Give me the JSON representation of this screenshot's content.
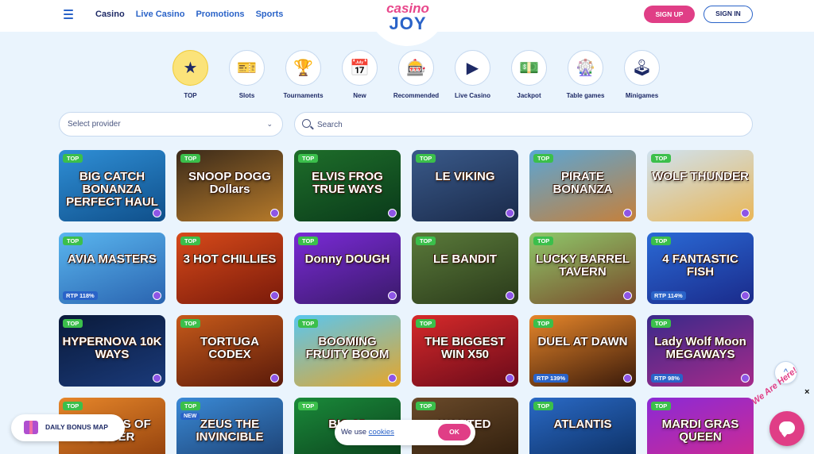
{
  "header": {
    "nav": [
      {
        "label": "Casino",
        "active": true
      },
      {
        "label": "Live Casino",
        "active": false
      },
      {
        "label": "Promotions",
        "active": false
      },
      {
        "label": "Sports",
        "active": false
      }
    ],
    "logo_top": "casino",
    "logo_bottom": "JOY",
    "signup_label": "SIGN UP",
    "signin_label": "SIGN IN"
  },
  "categories": [
    {
      "label": "TOP",
      "icon": "star-icon",
      "glyph": "★",
      "active": true
    },
    {
      "label": "Slots",
      "icon": "slot-ticket-icon",
      "glyph": "🎫",
      "active": false
    },
    {
      "label": "Tournaments",
      "icon": "trophy-icon",
      "glyph": "🏆",
      "active": false
    },
    {
      "label": "New",
      "icon": "new-calendar-icon",
      "glyph": "📅",
      "active": false
    },
    {
      "label": "Recommended",
      "icon": "win-badge-icon",
      "glyph": "🎰",
      "active": false
    },
    {
      "label": "Live Casino",
      "icon": "play-icon",
      "glyph": "▶",
      "active": false
    },
    {
      "label": "Jackpot",
      "icon": "money-icon",
      "glyph": "💵",
      "active": false
    },
    {
      "label": "Table games",
      "icon": "roulette-icon",
      "glyph": "🎡",
      "active": false
    },
    {
      "label": "Minigames",
      "icon": "joystick-icon",
      "glyph": "🕹",
      "active": false
    }
  ],
  "filters": {
    "provider_placeholder": "Select provider",
    "search_placeholder": "Search"
  },
  "games": [
    {
      "title": "BIG CATCH BONANZA PERFECT HAUL",
      "top": "TOP",
      "bg": "linear-gradient(160deg,#2f8fd6,#0f4f8a)"
    },
    {
      "title": "SNOOP DOGG Dollars",
      "top": "TOP",
      "bg": "linear-gradient(160deg,#3a2a1a,#b67a2a)"
    },
    {
      "title": "ELVIS FROG TRUE WAYS",
      "top": "TOP",
      "bg": "linear-gradient(160deg,#1e6e2a,#0a3a1a)"
    },
    {
      "title": "LE VIKING",
      "top": "TOP",
      "bg": "linear-gradient(160deg,#3a5a8a,#1a2a4a)"
    },
    {
      "title": "PIRATE BONANZA",
      "top": "TOP",
      "bg": "linear-gradient(160deg,#5aa6d6,#c6803a)"
    },
    {
      "title": "WOLF THUNDER",
      "top": "TOP",
      "bg": "linear-gradient(160deg,#cfe2f0,#e9b657)"
    },
    {
      "title": "AVIA MASTERS",
      "top": "TOP",
      "rtp": "RTP 118%",
      "bg": "linear-gradient(160deg,#5ab6ef,#2a64b0)"
    },
    {
      "title": "3 HOT CHILLIES",
      "top": "TOP",
      "bg": "linear-gradient(160deg,#d64a1a,#7a1a0a)"
    },
    {
      "title": "Donny DOUGH",
      "top": "TOP",
      "bg": "linear-gradient(160deg,#7a2ad6,#3a1a6a)"
    },
    {
      "title": "LE BANDIT",
      "top": "TOP",
      "bg": "linear-gradient(160deg,#5a7a3a,#2a3a1a)"
    },
    {
      "title": "LUCKY BARREL TAVERN",
      "top": "TOP",
      "bg": "linear-gradient(160deg,#8ec86a,#7a4a2a)"
    },
    {
      "title": "4 FANTASTIC FISH",
      "top": "TOP",
      "rtp": "RTP 114%",
      "bg": "linear-gradient(160deg,#2a6ad6,#1a2a8a)"
    },
    {
      "title": "HYPERNOVA 10K WAYS",
      "top": "TOP",
      "bg": "linear-gradient(160deg,#0a1a3a,#1a3a7a)"
    },
    {
      "title": "TORTUGA CODEX",
      "top": "TOP",
      "bg": "linear-gradient(160deg,#c65a1a,#5a1a0a)"
    },
    {
      "title": "BOOMING FRUITY BOOM",
      "top": "TOP",
      "bg": "linear-gradient(160deg,#5ac6ef,#e6a62a)"
    },
    {
      "title": "THE BIGGEST WIN X50",
      "top": "TOP",
      "bg": "linear-gradient(160deg,#d62a2a,#6a0a1a)"
    },
    {
      "title": "DUEL AT DAWN",
      "top": "TOP",
      "rtp": "RTP 139%",
      "bg": "linear-gradient(160deg,#e6862a,#3a1a0a)"
    },
    {
      "title": "Lady Wolf Moon MEGAWAYS",
      "top": "TOP",
      "rtp": "RTP 98%",
      "bg": "linear-gradient(160deg,#3a2a8a,#a62a8a)"
    },
    {
      "title": "LEGENDS OF POWER",
      "top": "TOP",
      "bg": "linear-gradient(160deg,#e6862a,#8a3a0a)"
    },
    {
      "title": "ZEUS THE INVINCIBLE",
      "top": "TOP",
      "new": "NEW",
      "bg": "linear-gradient(160deg,#3a8ad6,#1a3a6a)"
    },
    {
      "title": "BIG 25",
      "top": "TOP",
      "bg": "linear-gradient(160deg,#1a8a3a,#0a3a1a)"
    },
    {
      "title": "WANTED",
      "top": "TOP",
      "bg": "linear-gradient(160deg,#6a4a2a,#2a1a0a)"
    },
    {
      "title": "ATLANTIS",
      "top": "TOP",
      "bg": "linear-gradient(160deg,#2a6ac6,#0a2a5a)"
    },
    {
      "title": "MARDI GRAS QUEEN",
      "top": "TOP",
      "bg": "linear-gradient(160deg,#8a2ad6,#d62a8a)"
    }
  ],
  "bonus_label": "DAILY BONUS MAP",
  "cookie": {
    "text": "We use",
    "link": "cookies",
    "ok_label": "OK"
  },
  "chat": {
    "tag": "We Are Here!",
    "close": "×"
  },
  "scroll_top_glyph": "^"
}
